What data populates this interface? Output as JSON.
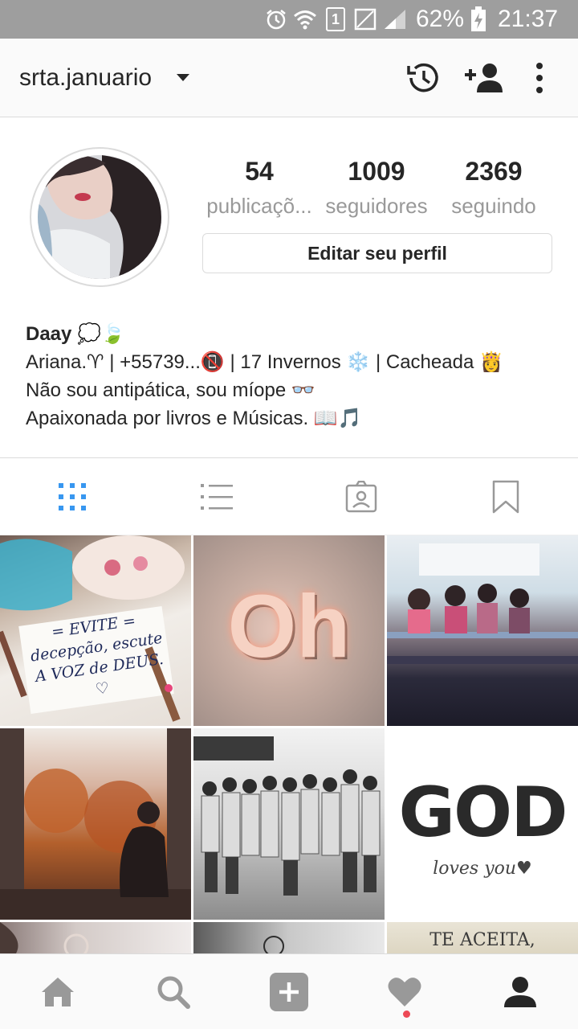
{
  "status_bar": {
    "battery": "62%",
    "time": "21:37",
    "sim_slot": "1"
  },
  "header": {
    "username": "srta.januario",
    "icons": [
      "chevron-down-icon",
      "history-icon",
      "add-user-icon",
      "more-vertical-icon"
    ]
  },
  "profile": {
    "stats": [
      {
        "value": "54",
        "label": "publicaçõ..."
      },
      {
        "value": "1009",
        "label": "seguidores"
      },
      {
        "value": "2369",
        "label": "seguindo"
      }
    ],
    "edit_button": "Editar seu perfil"
  },
  "bio": {
    "name": "Daay 💭🍃",
    "lines": [
      "Ariana.♈ | +55739...📵 | 17 Invernos ❄️ | Cacheada 👸",
      "Não sou antipática, sou míope 👓",
      "Apaixonada por livros e Músicas. 📖🎵"
    ]
  },
  "tabs": [
    {
      "icon": "grid-icon",
      "active": true
    },
    {
      "icon": "list-icon",
      "active": false
    },
    {
      "icon": "tagged-icon",
      "active": false
    },
    {
      "icon": "bookmark-icon",
      "active": false
    }
  ],
  "posts": [
    {
      "text": "= EVITE = decepção, escute A VOZ de DEUS. ♡"
    },
    {
      "text": "Oh"
    },
    {
      "text": ""
    },
    {
      "text": ""
    },
    {
      "text": ""
    },
    {
      "text": "GOD",
      "subtext": "loves you♥"
    },
    {
      "text": ""
    },
    {
      "text": ""
    },
    {
      "text": "TE ACEITA,"
    }
  ],
  "bottom_nav": [
    {
      "icon": "home-icon"
    },
    {
      "icon": "search-icon"
    },
    {
      "icon": "add-post-icon"
    },
    {
      "icon": "heart-icon",
      "has_notification": true
    },
    {
      "icon": "profile-icon",
      "active": true
    }
  ],
  "colors": {
    "status_bar": "#9e9e9e",
    "active_tab": "#3897f0",
    "inactive_icon": "#999999",
    "notification": "#ed4956"
  }
}
